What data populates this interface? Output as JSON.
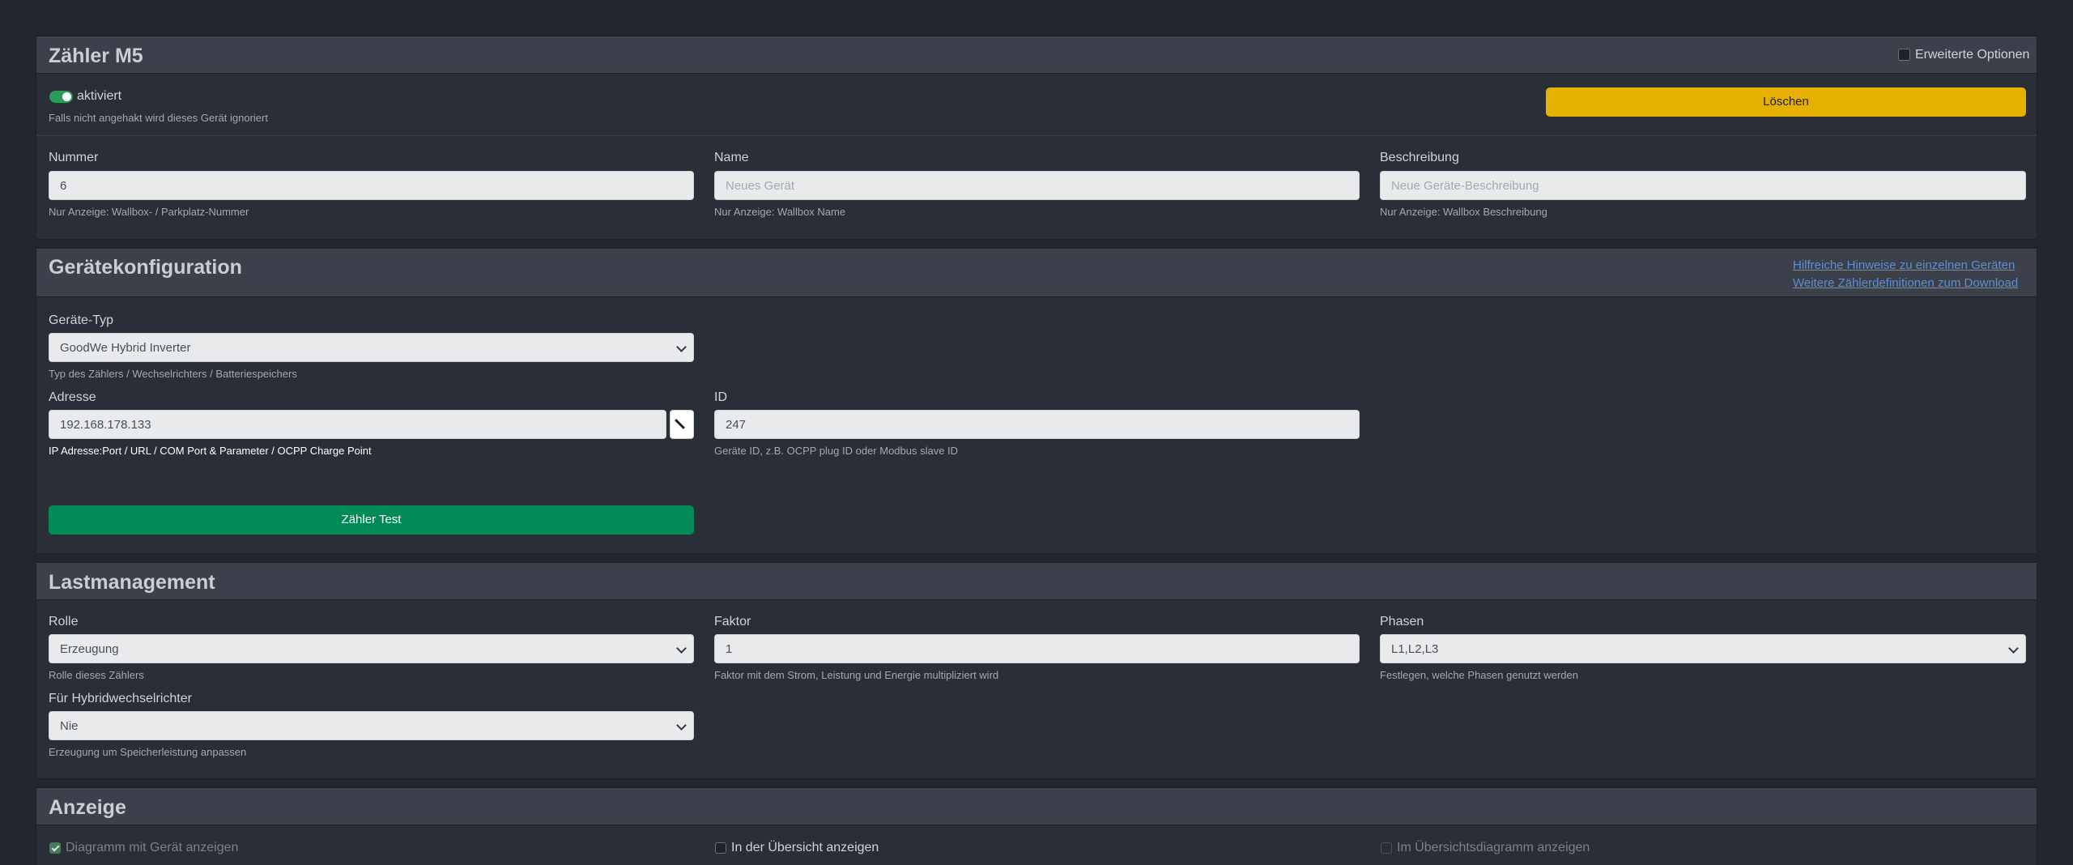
{
  "device_card": {
    "title": "Zähler M5",
    "advanced_options_label": "Erweiterte Optionen",
    "enabled_label": "aktiviert",
    "enabled_help": "Falls nicht angehakt wird dieses Gerät ignoriert",
    "delete_label": "Löschen",
    "number": {
      "label": "Nummer",
      "value": "6",
      "help": "Nur Anzeige: Wallbox- / Parkplatz-Nummer"
    },
    "name": {
      "label": "Name",
      "placeholder": "Neues Gerät",
      "help": "Nur Anzeige: Wallbox Name"
    },
    "description": {
      "label": "Beschreibung",
      "placeholder": "Neue Geräte-Beschreibung",
      "help": "Nur Anzeige: Wallbox Beschreibung"
    }
  },
  "config_card": {
    "title": "Gerätekonfiguration",
    "link_hints": "Hilfreiche Hinweise zu einzelnen Geräten",
    "link_download": "Weitere Zählerdefinitionen zum Download",
    "device_type": {
      "label": "Geräte-Typ",
      "value": "GoodWe Hybrid Inverter",
      "help": "Typ des Zählers / Wechselrichters / Batteriespeichers"
    },
    "address": {
      "label": "Adresse",
      "value": "192.168.178.133",
      "help": "IP Adresse:Port / URL / COM Port & Parameter / OCPP Charge Point"
    },
    "id": {
      "label": "ID",
      "value": "247",
      "help": "Geräte ID, z.B. OCPP plug ID oder Modbus slave ID"
    },
    "test_label": "Zähler Test"
  },
  "load_card": {
    "title": "Lastmanagement",
    "role": {
      "label": "Rolle",
      "value": "Erzeugung",
      "help": "Rolle dieses Zählers"
    },
    "factor": {
      "label": "Faktor",
      "value": "1",
      "help": "Faktor mit dem Strom, Leistung und Energie multipliziert wird"
    },
    "phases": {
      "label": "Phasen",
      "value": "L1,L2,L3",
      "help": "Festlegen, welche Phasen genutzt werden"
    },
    "hybrid": {
      "label": "Für Hybridwechselrichter",
      "value": "Nie",
      "help": "Erzeugung um Speicherleistung anpassen"
    }
  },
  "display_card": {
    "title": "Anzeige",
    "chart_with_device": "Diagramm mit Gerät anzeigen",
    "show_in_overview": "In der Übersicht anzeigen",
    "show_in_overview_chart": "Im Übersichtsdiagramm anzeigen"
  },
  "colors": {
    "delete": "#e5b000",
    "test": "#008a55",
    "header": "#3b404b",
    "link": "#5b8fd6"
  }
}
